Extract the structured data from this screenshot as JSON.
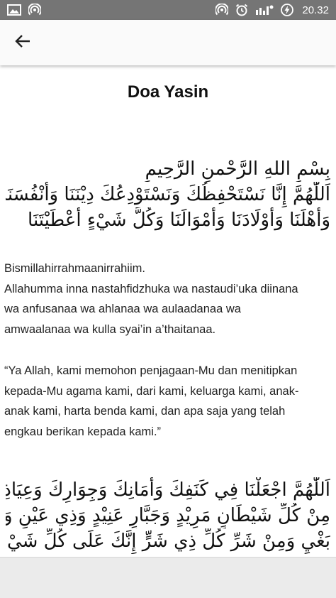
{
  "status_bar": {
    "time": "20.32",
    "icons_left": [
      "image-icon",
      "hotspot-icon"
    ],
    "icons_right": [
      "hotspot-icon",
      "alarm-icon",
      "notification-icon",
      "battery-charging-icon"
    ]
  },
  "app_bar": {
    "back_icon": "arrow-back-icon"
  },
  "content": {
    "title": "Doa Yasin",
    "arabic_1": [
      "بِسْمِ اللهِ الرَّحْمنِ الرَّحِيمِ",
      "اَللّٰهُمَّ إِنَّا نَسْتَحْفِظُكَ وَنَسْتَوْدِعُكَ دِيْنَنَا وَأَنْفُسَنَا",
      "وَأَهْلَنَا وَأَوْلَادَنَا وَأَمْوَالَنَا وَكُلَّ شَيْءٍ أَعْطَيْتَنَا"
    ],
    "latin_1": [
      "Bismillahirrahmaanirrahiim.",
      "Allahumma inna nastahfidzhuka wa nastaudi’uka diinana",
      "wa anfusanaa wa ahlanaa wa aulaadanaa wa",
      "amwaalanaa wa kulla syai’in a’thaitanaa."
    ],
    "latin_2": [
      "“Ya Allah, kami memohon penjagaan-Mu dan menitipkan",
      "kepada-Mu agama kami, dari kami, keluarga kami, anak-",
      "anak kami, harta benda kami, dan apa saja yang telah",
      "engkau berikan kepada kami.”"
    ],
    "arabic_2": [
      "اَللّٰهُمَّ اجْعَلْنَا فِي كَنَفِكَ وَأَمَانِكَ وَجِوَارِكَ وَعِيَاذِكَ",
      "مِنْ كُلِّ شَيْطَانٍ مَرِيْدٍ وَجَبَّارٍ عَنِيْدٍ وَذِي عَيْنٍ وَذِي",
      "بَغْيٍ وَمِنْ شَرِّ كُلِّ ذِي شَرٍّ إِنَّكَ عَلَى كُلِّ شَيْءٍ قَدِيْرٌ"
    ]
  },
  "colors": {
    "status_bar_bg": "#757575",
    "app_bar_bg": "#fafafa",
    "bottom_area_bg": "#ebebeb"
  }
}
